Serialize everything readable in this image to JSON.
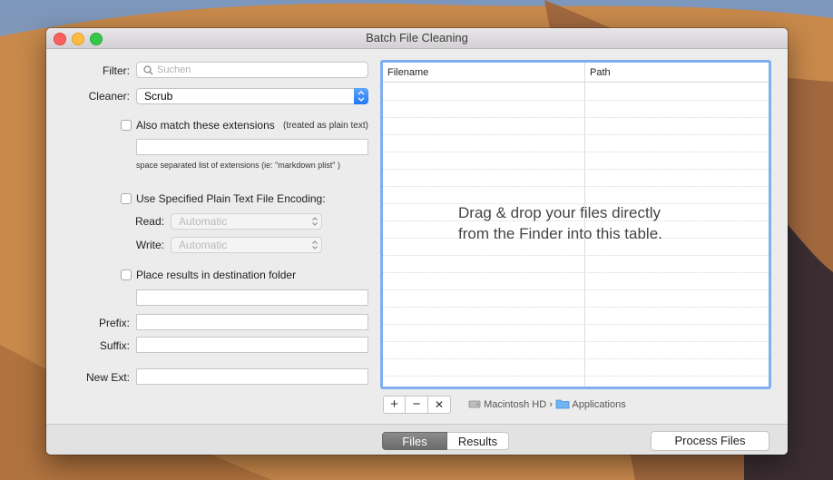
{
  "window": {
    "title": "Batch File Cleaning"
  },
  "form": {
    "filter_label": "Filter:",
    "filter_placeholder": "Suchen",
    "cleaner_label": "Cleaner:",
    "cleaner_value": "Scrub",
    "also_match_label": "Also match these extensions",
    "treated_as_note": "(treated as plain text)",
    "extensions_value": "",
    "extensions_hint": "space separated list of extensions (ie: \"markdown plist\" )",
    "encoding_label": "Use Specified Plain Text File Encoding:",
    "read_label": "Read:",
    "read_value": "Automatic",
    "write_label": "Write:",
    "write_value": "Automatic",
    "destination_label": "Place results in destination folder",
    "destination_value": "",
    "prefix_label": "Prefix:",
    "prefix_value": "",
    "suffix_label": "Suffix:",
    "suffix_value": "",
    "new_ext_label": "New Ext:",
    "new_ext_value": ""
  },
  "table": {
    "columns": [
      "Filename",
      "Path"
    ],
    "drop_message_line1": "Drag & drop your files directly",
    "drop_message_line2": "from the Finder into this table.",
    "rows": []
  },
  "table_controls": {
    "add": "+",
    "remove": "−",
    "clear": "✕"
  },
  "path": {
    "volume": "Macintosh HD",
    "separator": "›",
    "folder": "Applications"
  },
  "bottom": {
    "tab_files": "Files",
    "tab_results": "Results",
    "active_tab": "Files",
    "process_button": "Process Files"
  },
  "colors": {
    "accent": "#2176f5",
    "table_focus_ring": "#80aef0"
  }
}
